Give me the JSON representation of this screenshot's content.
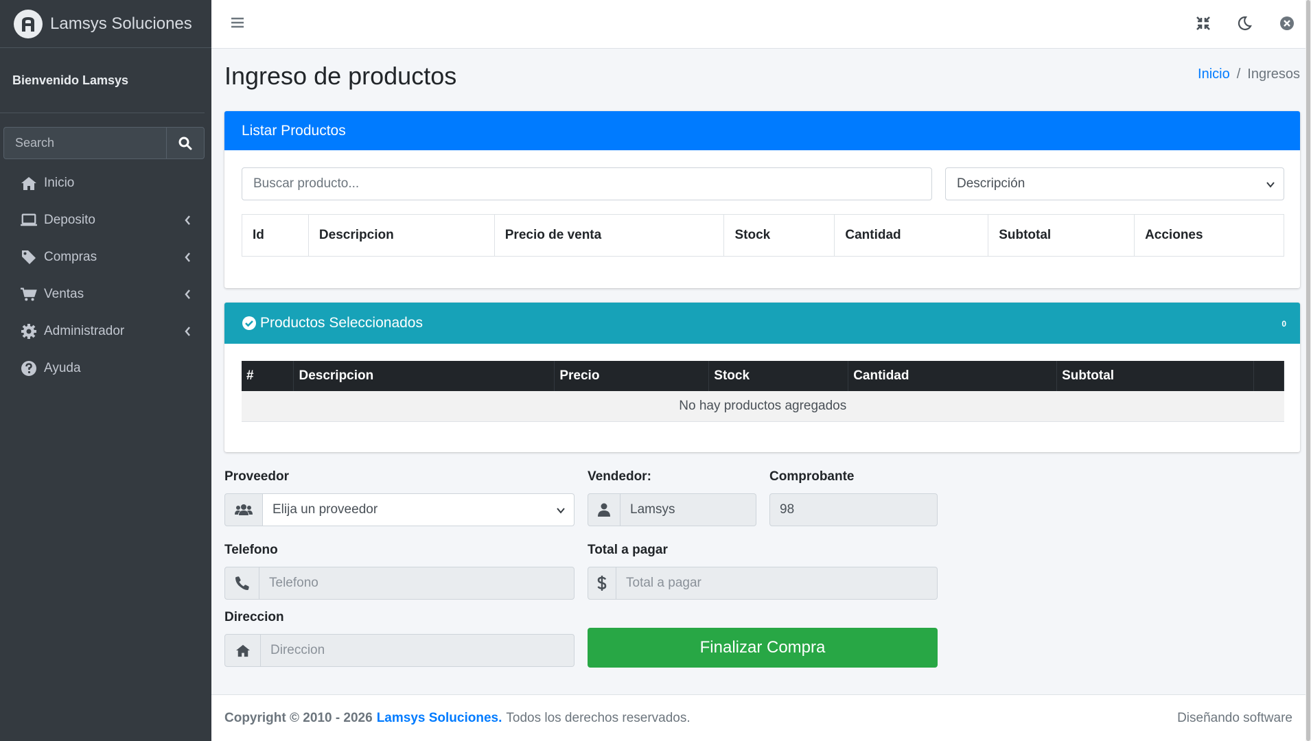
{
  "brand": {
    "name": "Lamsys Soluciones"
  },
  "user": {
    "welcome": "Bienvenido Lamsys"
  },
  "sidebar": {
    "search_placeholder": "Search",
    "items": [
      {
        "label": "Inicio",
        "icon": "home-icon",
        "has_children": false
      },
      {
        "label": "Deposito",
        "icon": "laptop-icon",
        "has_children": true
      },
      {
        "label": "Compras",
        "icon": "tag-icon",
        "has_children": true
      },
      {
        "label": "Ventas",
        "icon": "cart-icon",
        "has_children": true
      },
      {
        "label": "Administrador",
        "icon": "gear-icon",
        "has_children": true
      },
      {
        "label": "Ayuda",
        "icon": "help-icon",
        "has_children": false
      }
    ]
  },
  "page": {
    "title": "Ingreso de productos"
  },
  "breadcrumb": {
    "home": "Inicio",
    "separator": "/",
    "current": "Ingresos"
  },
  "list_card": {
    "title": "Listar Productos",
    "search_placeholder": "Buscar producto...",
    "filter_selected": "Descripción",
    "columns": [
      "Id",
      "Descripcion",
      "Precio de venta",
      "Stock",
      "Cantidad",
      "Subtotal",
      "Acciones"
    ]
  },
  "selected_card": {
    "title": "Productos Seleccionados",
    "count": "0",
    "columns": [
      "#",
      "Descripcion",
      "Precio",
      "Stock",
      "Cantidad",
      "Subtotal",
      ""
    ],
    "empty_message": "No hay productos agregados"
  },
  "form": {
    "proveedor_label": "Proveedor",
    "proveedor_selected": "Elija un proveedor",
    "vendedor_label": "Vendedor:",
    "vendedor_value": "Lamsys",
    "comprobante_label": "Comprobante",
    "comprobante_value": "98",
    "telefono_label": "Telefono",
    "telefono_placeholder": "Telefono",
    "total_label": "Total a pagar",
    "total_placeholder": "Total a pagar",
    "direccion_label": "Direccion",
    "direccion_placeholder": "Direccion",
    "finish_button": "Finalizar Compra"
  },
  "footer": {
    "copyright": "Copyright © 2010 - 2026",
    "company": "Lamsys Soluciones.",
    "rights": "Todos los derechos reservados.",
    "right_text": "Diseñando software"
  },
  "colors": {
    "primary": "#007bff",
    "info": "#17a2b8",
    "success": "#28a745",
    "sidebar": "#343a40"
  }
}
